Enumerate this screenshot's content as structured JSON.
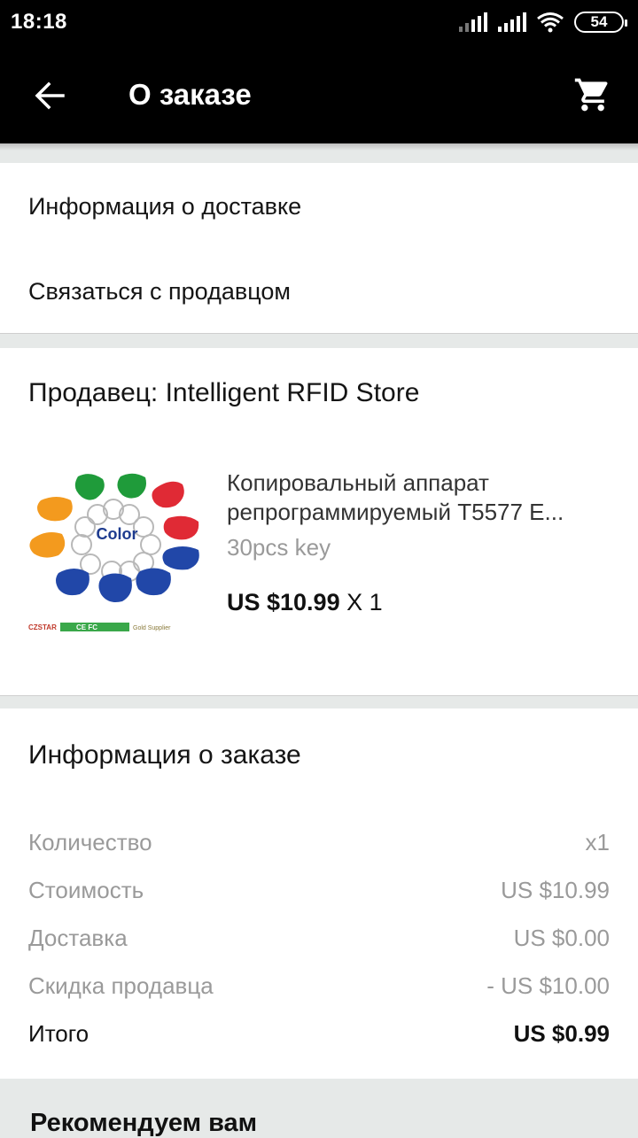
{
  "status_bar": {
    "time": "18:18",
    "battery": "54",
    "icons": [
      "signal-icon",
      "signal-icon",
      "wifi-icon",
      "battery-icon"
    ]
  },
  "toolbar": {
    "title": "О заказе",
    "back_icon": "arrow-left-icon",
    "cart_icon": "cart-icon"
  },
  "links": {
    "delivery": "Информация о доставке",
    "contact": "Связаться с продавцом"
  },
  "seller": {
    "title": "Продавец: Intelligent RFID Store",
    "product": {
      "name_line1": "Копировальный аппарат",
      "name_line2": "репрограммируемый T5577 E...",
      "variant": "30pcs key",
      "price": "US $10.99",
      "quantity": "X 1",
      "image_text": {
        "center": "Color",
        "brand": "CZSTAR",
        "marks": "CE FC",
        "supplier": "Gold Supplier"
      }
    }
  },
  "order": {
    "title": "Информация о заказе",
    "rows": [
      {
        "label": "Количество",
        "value": "x1"
      },
      {
        "label": "Стоимость",
        "value": "US $10.99"
      },
      {
        "label": "Доставка",
        "value": "US $0.00"
      },
      {
        "label": "Скидка продавца",
        "value": "- US $10.00"
      }
    ],
    "total": {
      "label": "Итого",
      "value": "US $0.99"
    }
  },
  "recommend": {
    "title": "Рекомендуем вам"
  },
  "colors": {
    "toolbar_bg": "#000000",
    "page_bg": "#e6e9e8",
    "muted_text": "#9a9a9a"
  }
}
